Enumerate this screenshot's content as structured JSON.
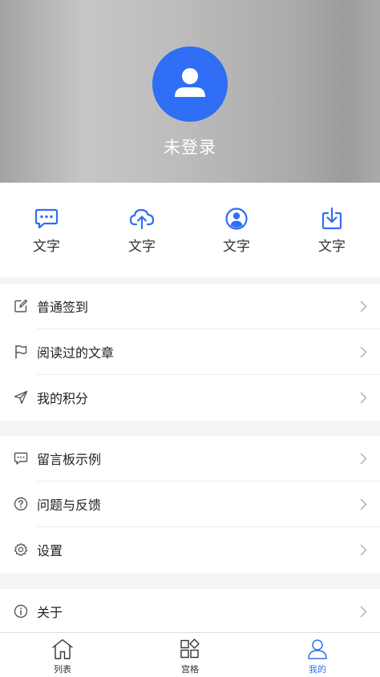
{
  "header": {
    "status": "未登录",
    "avatar_icon": "user-icon",
    "accent": "#2f6ef5"
  },
  "quick_actions": [
    {
      "icon": "message-icon",
      "label": "文字"
    },
    {
      "icon": "cloud-upload-icon",
      "label": "文字"
    },
    {
      "icon": "user-circle-icon",
      "label": "文字"
    },
    {
      "icon": "download-icon",
      "label": "文字"
    }
  ],
  "menu_groups": [
    [
      {
        "icon": "edit-icon",
        "label": "普通签到"
      },
      {
        "icon": "flag-icon",
        "label": "阅读过的文章"
      },
      {
        "icon": "send-icon",
        "label": "我的积分"
      }
    ],
    [
      {
        "icon": "comment-icon",
        "label": "留言板示例"
      },
      {
        "icon": "question-icon",
        "label": "问题与反馈"
      },
      {
        "icon": "settings-icon",
        "label": "设置"
      }
    ],
    [
      {
        "icon": "info-icon",
        "label": "关于"
      }
    ]
  ],
  "tabbar": [
    {
      "icon": "home-icon",
      "label": "列表",
      "active": false
    },
    {
      "icon": "grid-icon",
      "label": "宫格",
      "active": false
    },
    {
      "icon": "person-icon",
      "label": "我的",
      "active": true
    }
  ]
}
